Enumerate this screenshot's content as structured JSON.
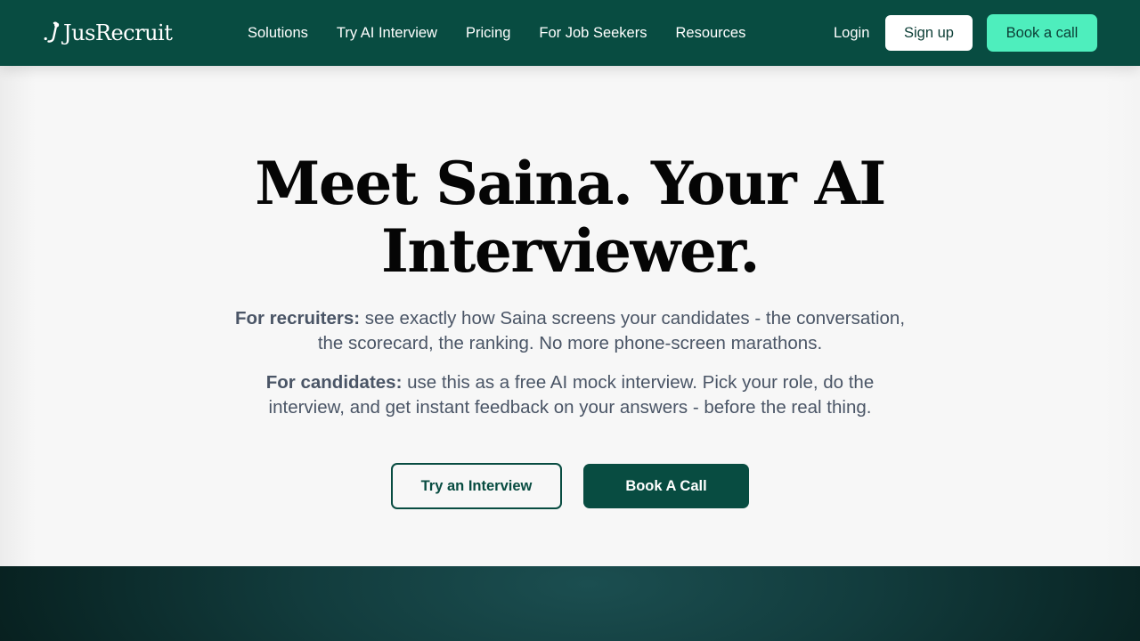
{
  "header": {
    "logo_text": "JusRecruit",
    "nav": [
      {
        "label": "Solutions"
      },
      {
        "label": "Try AI Interview"
      },
      {
        "label": "Pricing"
      },
      {
        "label": "For Job Seekers"
      },
      {
        "label": "Resources"
      }
    ],
    "login_label": "Login",
    "signup_label": "Sign up",
    "book_call_label": "Book a call"
  },
  "hero": {
    "headline_line1": "Meet Saina. Your AI",
    "headline_line2": "Interviewer.",
    "recruiters_label": "For recruiters:",
    "recruiters_text": " see exactly how Saina screens your candidates - the conversation, the scorecard, the ranking. No more phone-screen marathons.",
    "candidates_label": "For candidates:",
    "candidates_text": " use this as a free AI mock interview. Pick your role, do the interview, and get instant feedback on your answers - before the real thing.",
    "try_button_label": "Try an Interview",
    "book_button_label": "Book A Call"
  },
  "colors": {
    "header_bg": "#084c41",
    "accent_mint": "#4eeebd",
    "primary_dark_green": "#084c41",
    "body_text": "#4a5566",
    "page_bg": "#f7f7f7"
  },
  "icons": {
    "logo": "jusrecruit-logo-mark"
  }
}
